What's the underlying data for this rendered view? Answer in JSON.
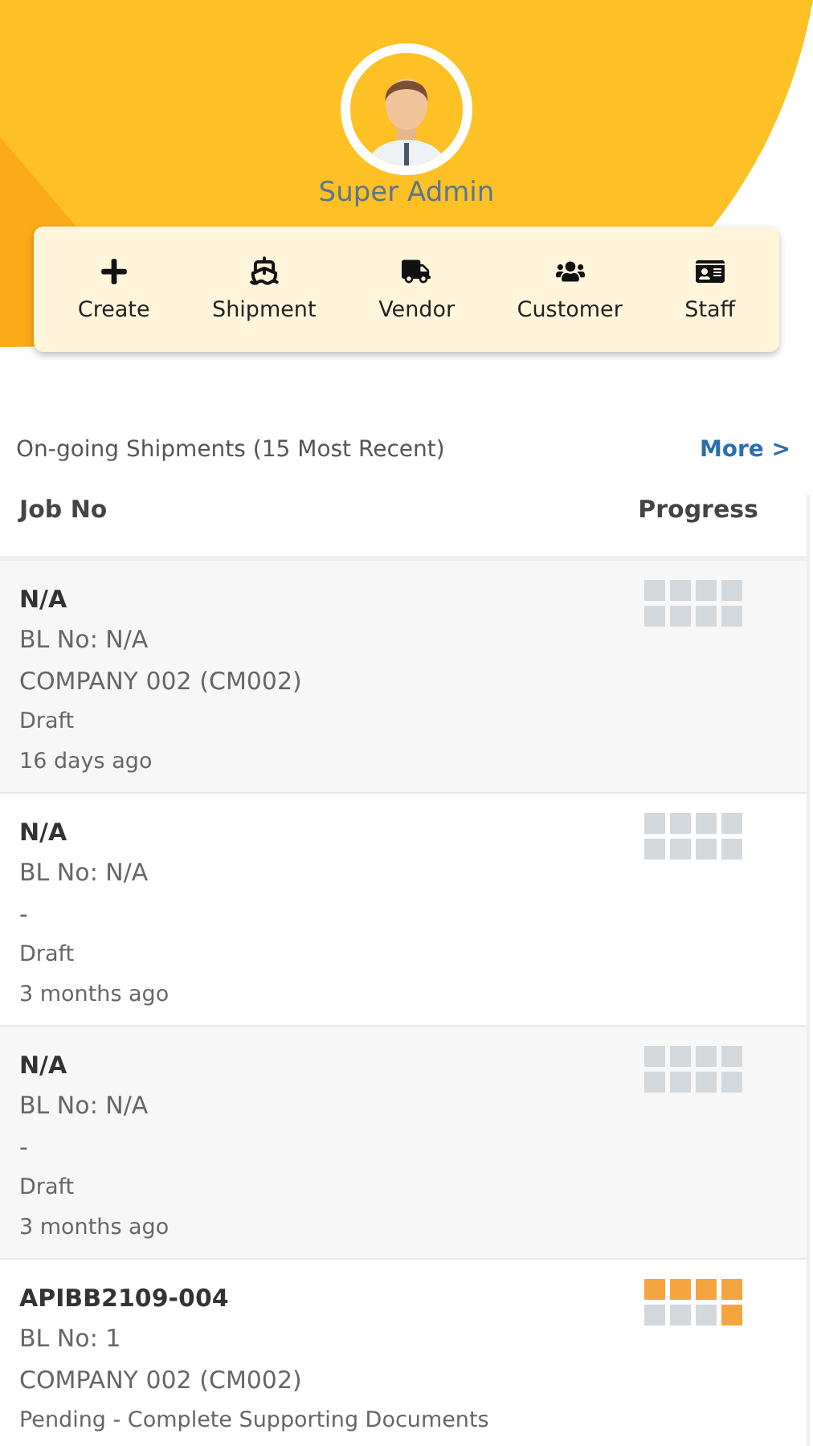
{
  "profile": {
    "name": "Super Admin"
  },
  "actions": [
    {
      "kind": "create",
      "label": "Create"
    },
    {
      "kind": "shipment",
      "label": "Shipment"
    },
    {
      "kind": "vendor",
      "label": "Vendor"
    },
    {
      "kind": "customer",
      "label": "Customer"
    },
    {
      "kind": "staff",
      "label": "Staff"
    }
  ],
  "section": {
    "title": "On-going Shipments (15 Most Recent)",
    "link": "More >"
  },
  "table": {
    "columns": [
      "Job No",
      "Progress"
    ],
    "rows": [
      {
        "job_no": "N/A",
        "bl_no": "BL No: N/A",
        "company": "COMPANY 002 (CM002)",
        "status": "Draft",
        "age": "16 days ago",
        "progress": [
          false,
          false,
          false,
          false,
          false,
          false,
          false,
          false
        ]
      },
      {
        "job_no": "N/A",
        "bl_no": "BL No: N/A",
        "company": "-",
        "status": "Draft",
        "age": "3 months ago",
        "progress": [
          false,
          false,
          false,
          false,
          false,
          false,
          false,
          false
        ]
      },
      {
        "job_no": "N/A",
        "bl_no": "BL No: N/A",
        "company": "-",
        "status": "Draft",
        "age": "3 months ago",
        "progress": [
          false,
          false,
          false,
          false,
          false,
          false,
          false,
          false
        ]
      },
      {
        "job_no": "APIBB2109-004",
        "bl_no": "BL No: 1",
        "company": "COMPANY 002 (CM002)",
        "status": "Pending - Complete Supporting Documents",
        "progress": [
          true,
          true,
          true,
          true,
          false,
          false,
          false,
          true
        ]
      }
    ]
  }
}
